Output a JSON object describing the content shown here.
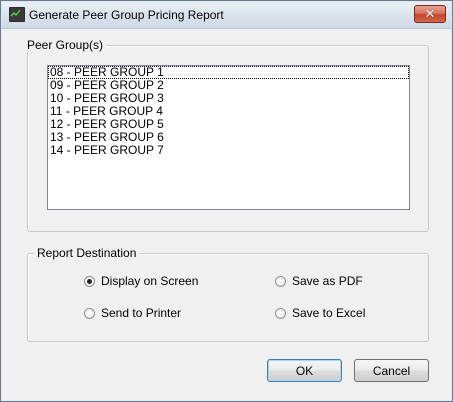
{
  "window": {
    "title": "Generate Peer Group Pricing Report",
    "close_label": "✕"
  },
  "peer_groups": {
    "legend": "Peer Group(s)",
    "items": [
      "08 - PEER GROUP 1",
      "09 - PEER GROUP 2",
      "10 - PEER GROUP 3",
      "11 - PEER GROUP 4",
      "12 - PEER GROUP 5",
      "13 - PEER GROUP 6",
      "14 - PEER GROUP 7"
    ],
    "focused_index": 0
  },
  "report_destination": {
    "legend": "Report Destination",
    "options": {
      "display_on_screen": {
        "label": "Display on Screen",
        "checked": true
      },
      "save_as_pdf": {
        "label": "Save as PDF",
        "checked": false
      },
      "send_to_printer": {
        "label": "Send to Printer",
        "checked": false
      },
      "save_to_excel": {
        "label": "Save to Excel",
        "checked": false
      }
    }
  },
  "buttons": {
    "ok": "OK",
    "cancel": "Cancel"
  }
}
